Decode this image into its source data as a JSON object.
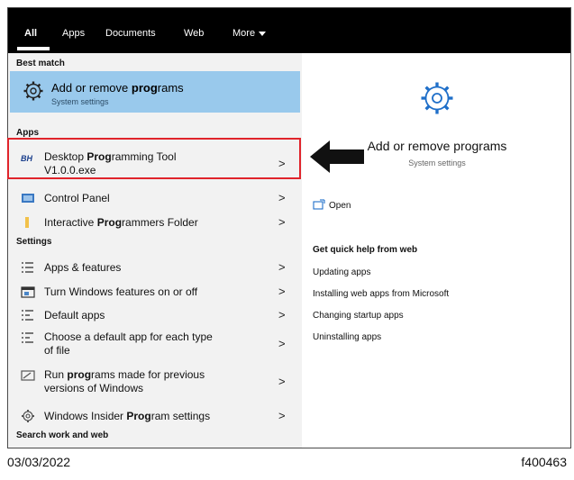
{
  "tabs": [
    {
      "label": "All",
      "active": true
    },
    {
      "label": "Apps"
    },
    {
      "label": "Documents"
    },
    {
      "label": "Web"
    },
    {
      "label": "More"
    }
  ],
  "sections": {
    "best_match": "Best match",
    "apps": "Apps",
    "settings": "Settings",
    "search_web": "Search work and web"
  },
  "best_match": {
    "title_pre": "Add or remove ",
    "title_bold": "prog",
    "title_post": "rams",
    "subtitle": "System settings",
    "icon": "gear-icon"
  },
  "apps": [
    {
      "pre": "Desktop ",
      "bold": "Prog",
      "post": "ramming Tool",
      "line2": "V1.0.0.exe",
      "icon": "app-icon"
    },
    {
      "pre": "Control Panel",
      "bold": "",
      "post": "",
      "icon": "control-panel-icon"
    },
    {
      "pre": "Interactive ",
      "bold": "Prog",
      "post": "rammers Folder",
      "icon": "folder-icon"
    }
  ],
  "settings": [
    {
      "pre": "Apps & features",
      "bold": "",
      "post": "",
      "icon": "list-icon"
    },
    {
      "pre": "Turn Windows features on or off",
      "bold": "",
      "post": "",
      "icon": "window-icon"
    },
    {
      "pre": "Default apps",
      "bold": "",
      "post": "",
      "icon": "list-icon"
    },
    {
      "pre": "Choose a default app for each type",
      "bold": "",
      "post": "",
      "line2": "of file",
      "icon": "list-icon"
    },
    {
      "pre": "Run ",
      "bold": "prog",
      "post": "rams made for previous",
      "line2": "versions of Windows",
      "icon": "compat-icon"
    },
    {
      "pre": "Windows Insider ",
      "bold": "Prog",
      "post": "ram settings",
      "icon": "gear-icon"
    }
  ],
  "chevron": ">",
  "right_panel": {
    "title": "Add or remove programs",
    "subtitle": "System settings",
    "open": "Open",
    "help_heading": "Get quick help from web",
    "links": [
      "Updating apps",
      "Installing web apps from Microsoft",
      "Changing startup apps",
      "Uninstalling apps"
    ]
  },
  "footer": {
    "date": "03/03/2022",
    "code": "f400463"
  }
}
